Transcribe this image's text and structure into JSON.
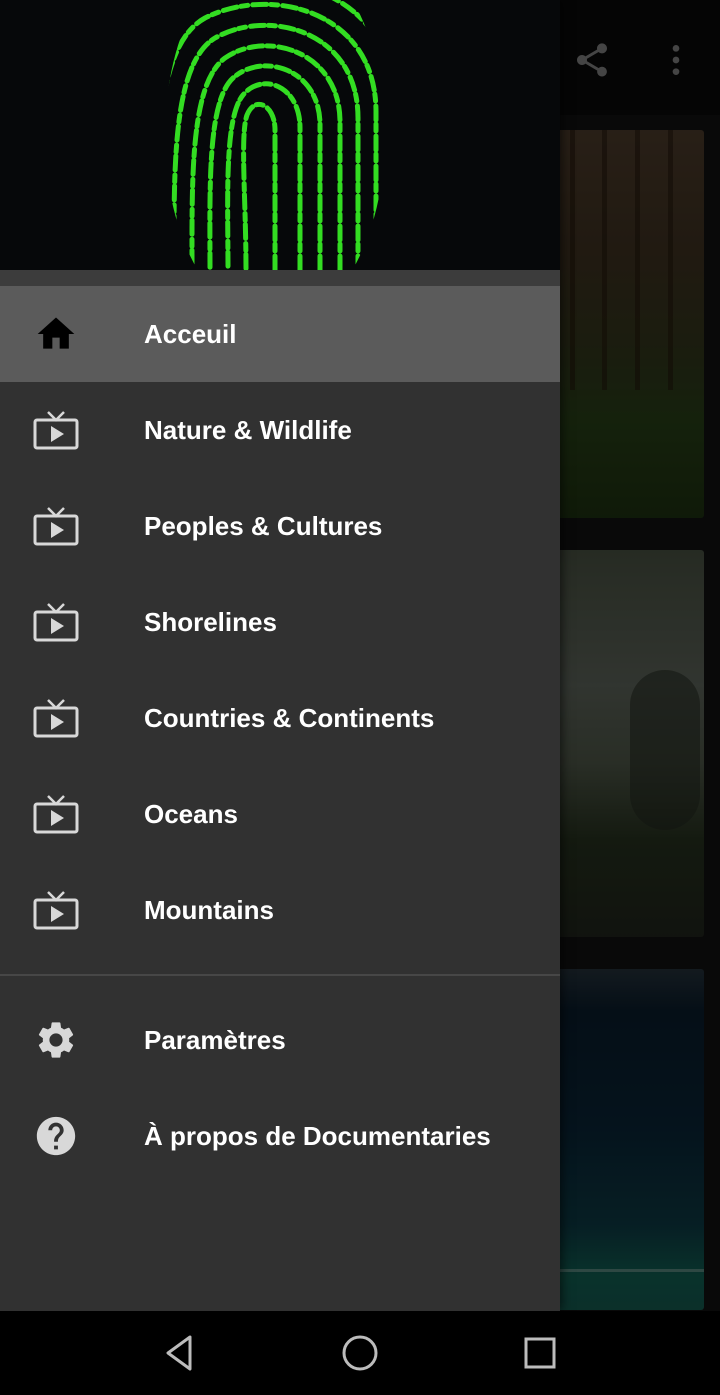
{
  "app_bar": {
    "actions": [
      {
        "icon": "share-icon"
      },
      {
        "icon": "more-vert-icon"
      }
    ]
  },
  "drawer": {
    "header_image": "green-fingerprint-logo",
    "primary_items": [
      {
        "label": "Acceuil",
        "icon": "home-icon",
        "selected": true
      },
      {
        "label": "Nature & Wildlife",
        "icon": "tv-play-icon",
        "selected": false
      },
      {
        "label": "Peoples & Cultures",
        "icon": "tv-play-icon",
        "selected": false
      },
      {
        "label": "Shorelines",
        "icon": "tv-play-icon",
        "selected": false
      },
      {
        "label": "Countries & Continents",
        "icon": "tv-play-icon",
        "selected": false
      },
      {
        "label": "Oceans",
        "icon": "tv-play-icon",
        "selected": false
      },
      {
        "label": "Mountains",
        "icon": "tv-play-icon",
        "selected": false
      }
    ],
    "secondary_items": [
      {
        "label": "Paramètres",
        "icon": "settings-gear-icon"
      },
      {
        "label": "À propos de Documentaries",
        "icon": "help-circle-icon"
      }
    ]
  },
  "background_cards": [
    {
      "subject": "forest"
    },
    {
      "subject": "foggy-tree"
    },
    {
      "subject": "ocean"
    }
  ],
  "nav_bar": {
    "buttons": [
      {
        "icon": "back-triangle-icon"
      },
      {
        "icon": "home-circle-icon"
      },
      {
        "icon": "recents-square-icon"
      }
    ]
  },
  "colors": {
    "drawer_bg": "#313131",
    "selected_bg": "#5b5b5b",
    "text": "#ffffff",
    "icon": "#d8d8d8",
    "fingerprint": "#33dd22"
  }
}
